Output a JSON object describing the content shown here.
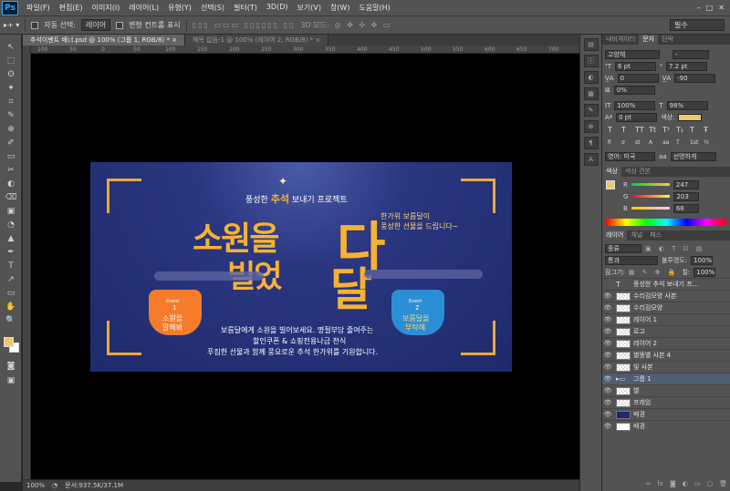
{
  "app": {
    "logo": "Ps"
  },
  "menu": [
    "파일(F)",
    "편집(E)",
    "이미지(I)",
    "레이어(L)",
    "유형(Y)",
    "선택(S)",
    "필터(T)",
    "3D(D)",
    "보기(V)",
    "창(W)",
    "도움말(H)"
  ],
  "window_controls": [
    "–",
    "□",
    "✕"
  ],
  "options": {
    "auto_select_label": "자동 선택:",
    "auto_select_value": "레이어",
    "transform_label": "변형 컨트롤 표시",
    "mode_3d": "3D 모드:",
    "workspace": "필수"
  },
  "tabs": [
    {
      "label": "추석이벤트 배너.psd @ 100% (그룹 1, RGB/8) *",
      "close": "×"
    },
    {
      "label": "제목 없음-1 @ 100% (레이어 2, RGB/8) *",
      "close": "×"
    }
  ],
  "ruler": [
    "100",
    "50",
    "0",
    "50",
    "100",
    "150",
    "200",
    "250",
    "300",
    "350",
    "400",
    "450",
    "500",
    "550",
    "600",
    "650",
    "700"
  ],
  "status": {
    "zoom": "100%",
    "doc": "문서:937.5K/37.1M"
  },
  "banner": {
    "subtitle_pre": "풍성한",
    "subtitle_bold": "추석",
    "subtitle_post": "보내기 프로젝트",
    "headline1": "소원을",
    "headline2": "빌었",
    "moon1": "다",
    "moon2": "달",
    "side1": "한가위 보름달이",
    "side2": "풍성한 선물을 드립니다~",
    "pouch_left_event": "Event",
    "pouch_left_num": "1",
    "pouch_left_text1": "소원을",
    "pouch_left_text2": "말해봐",
    "pouch_right_event": "Event",
    "pouch_right_num": "2",
    "pouch_right_text1": "보름달을",
    "pouch_right_text2": "부탁해",
    "body1": "보름달에게 소원을 빌어보세요. 명절부담 줄여주는",
    "body2": "할인쿠폰 & 쇼핑전용나금 천식",
    "body3": "푸짐한 선물과 함께 풍요로운 추석 한가위를 기원합니다."
  },
  "char_panel": {
    "tabs": [
      "내비게이터",
      "문자",
      "단락"
    ],
    "font": "고양체",
    "style": "-",
    "size": "6 pt",
    "leading": "7.2 pt",
    "kerning": "0",
    "tracking": "-90",
    "scale_pct": "0%",
    "vscale": "100%",
    "hscale": "98%",
    "baseline": "0 pt",
    "color_label": "색상:",
    "type_buttons": [
      "T",
      "T",
      "TT",
      "Tt",
      "T¹",
      "T₁",
      "T",
      "Ŧ"
    ],
    "opentype": [
      "fi",
      "ơ",
      "st",
      "A",
      "aa",
      "T",
      "1st",
      "½"
    ],
    "language": "영어: 미국",
    "aa": "선명하게",
    "color": "#f0c96b"
  },
  "color_panel": {
    "tabs": [
      "색상",
      "색상 견본"
    ],
    "r": "247",
    "g": "203",
    "b": "68",
    "r_label": "R",
    "g_label": "G",
    "b_label": "B"
  },
  "layers_panel": {
    "tabs": [
      "레이어",
      "채널",
      "패스"
    ],
    "filter": "종류",
    "blend": "통과",
    "opacity_label": "불투명도:",
    "opacity": "100%",
    "lock_label": "잠그기:",
    "fill_label": "칠:",
    "fill": "100%",
    "layers": [
      {
        "name": "풍성한 추석 보내기 프...",
        "kind": "text",
        "sel": false
      },
      {
        "name": "수리검모양 사본",
        "kind": "img",
        "sel": false
      },
      {
        "name": "수리검모양",
        "kind": "img",
        "sel": false
      },
      {
        "name": "레이어 1",
        "kind": "mask",
        "sel": false
      },
      {
        "name": "로고",
        "kind": "img",
        "sel": false
      },
      {
        "name": "레이어 2",
        "kind": "img",
        "sel": false
      },
      {
        "name": "별똥별 사본 4",
        "kind": "mask",
        "sel": false
      },
      {
        "name": "빛 사본",
        "kind": "img",
        "sel": false
      },
      {
        "name": "그룹 1",
        "kind": "group",
        "sel": true
      },
      {
        "name": "별",
        "kind": "img",
        "sel": false
      },
      {
        "name": "프레임",
        "kind": "img",
        "sel": false
      },
      {
        "name": "배경",
        "kind": "fill",
        "sel": false
      },
      {
        "name": "배경",
        "kind": "white",
        "sel": false
      }
    ]
  },
  "tools": [
    "↖",
    "⬚",
    "ʘ",
    "✦",
    "⌗",
    "✎",
    "⊕",
    "✐",
    "▭",
    "✂",
    "◐",
    "⌫",
    "▣",
    "◔",
    "▲",
    "✒",
    "T",
    "↗",
    "▭",
    "✋",
    "🔍"
  ]
}
